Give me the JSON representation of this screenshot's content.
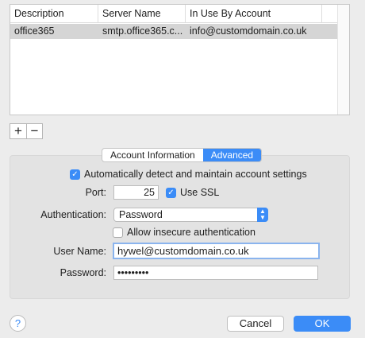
{
  "table": {
    "columns": [
      "Description",
      "Server Name",
      "In Use By Account"
    ],
    "rows": [
      {
        "description": "office365",
        "server": "smtp.office365.c...",
        "account": "info@customdomain.co.uk"
      }
    ]
  },
  "controls": {
    "add": "+",
    "remove": "−"
  },
  "tabs": [
    {
      "label": "Account Information",
      "active": false
    },
    {
      "label": "Advanced",
      "active": true
    }
  ],
  "advanced": {
    "auto_detect": {
      "label": "Automatically detect and maintain account settings",
      "checked": true
    },
    "port": {
      "label": "Port:",
      "value": "25"
    },
    "ssl": {
      "label": "Use SSL",
      "checked": true
    },
    "authentication": {
      "label": "Authentication:",
      "value": "Password"
    },
    "insecure": {
      "label": "Allow insecure authentication",
      "checked": false
    },
    "username": {
      "label": "User Name:",
      "value": "hywel@customdomain.co.uk"
    },
    "password": {
      "label": "Password:",
      "value": "•••••••••"
    }
  },
  "footer": {
    "help": "?",
    "cancel": "Cancel",
    "ok": "OK"
  },
  "colors": {
    "accent": "#3b8cf7"
  }
}
